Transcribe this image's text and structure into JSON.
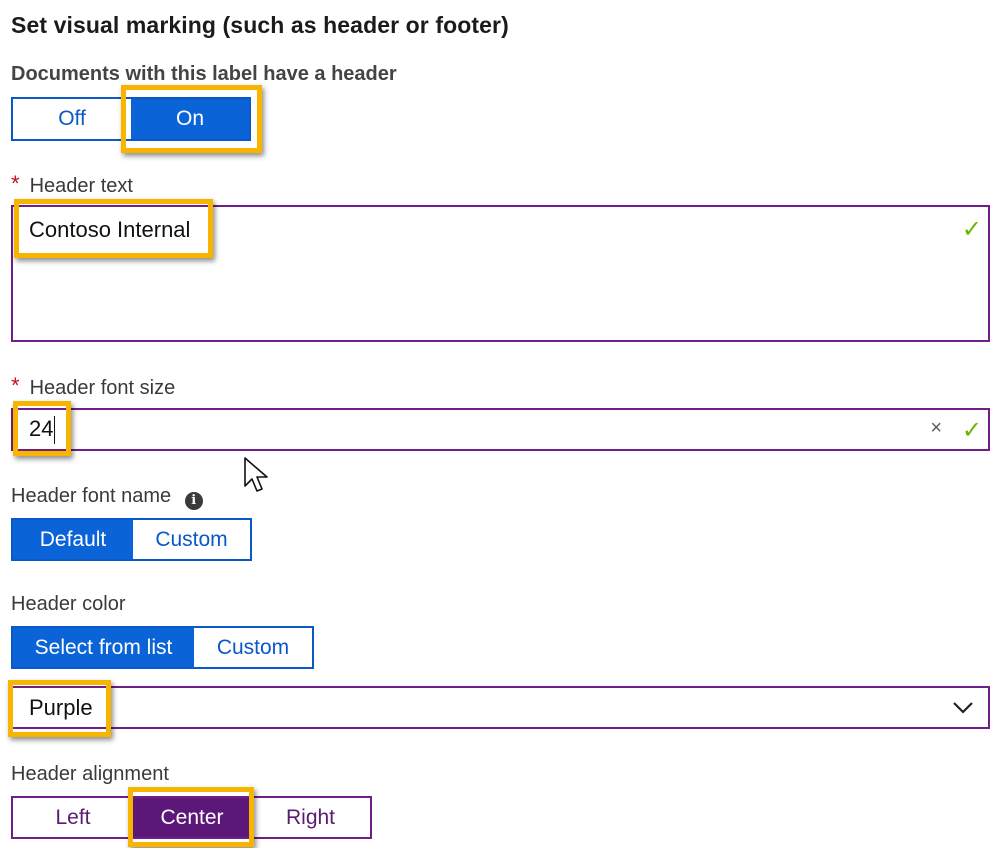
{
  "section_title": "Set visual marking (such as header or footer)",
  "header_toggle": {
    "label": "Documents with this label have a header",
    "off_label": "Off",
    "on_label": "On",
    "selected": "On"
  },
  "header_text": {
    "required_mark": "*",
    "label": "Header text",
    "value": "Contoso Internal",
    "valid_icon": "checkmark-icon"
  },
  "header_font_size": {
    "required_mark": "*",
    "label": "Header font size",
    "value": "24",
    "clear_icon": "×",
    "valid_icon": "checkmark-icon"
  },
  "header_font_name": {
    "label": "Header font name",
    "info_icon": "i",
    "options": [
      "Default",
      "Custom"
    ],
    "selected": "Default"
  },
  "header_color": {
    "label": "Header color",
    "options": [
      "Select from list",
      "Custom"
    ],
    "selected": "Select from list",
    "dropdown_value": "Purple"
  },
  "header_alignment": {
    "label": "Header alignment",
    "options": [
      "Left",
      "Center",
      "Right"
    ],
    "selected": "Center"
  },
  "colors": {
    "accent_blue": "#0b63d8",
    "accent_purple": "#5b1879",
    "highlight": "#f7b500",
    "valid_green": "#6bb700",
    "required_red": "#c50f1f"
  }
}
